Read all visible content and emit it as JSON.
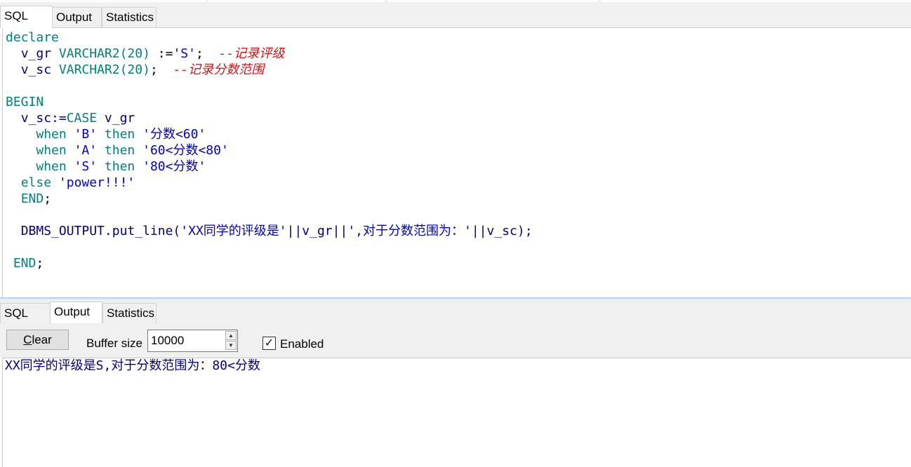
{
  "top_tabs": [
    {
      "label": "SQL",
      "active": true
    },
    {
      "label": "Output",
      "active": false
    },
    {
      "label": "Statistics",
      "active": false
    }
  ],
  "bottom_tabs": [
    {
      "label": "SQL",
      "active": false
    },
    {
      "label": "Output",
      "active": true
    },
    {
      "label": "Statistics",
      "active": false
    }
  ],
  "editor": {
    "l1": "declare",
    "l2_var": "v_gr",
    "l2_type": "VARCHAR2(20)",
    "l2_assign": ":=",
    "l2_str": "'S'",
    "l2_end": ";",
    "l2_cmt": "--记录评级",
    "l3_var": "v_sc",
    "l3_type": "VARCHAR2(20)",
    "l3_end": ";",
    "l3_cmt": "--记录分数范围",
    "l5": "BEGIN",
    "l6_var": "v_sc:=",
    "l6_kw": "CASE",
    "l6_rest": "v_gr",
    "when": "when",
    "then": "then",
    "l7_str1": "'B'",
    "l7_str2": "'分数<60'",
    "l8_str1": "'A'",
    "l8_str2": "'60<分数<80'",
    "l9_str1": "'S'",
    "l9_str2": "'80<分数'",
    "l10_kw": "else",
    "l10_str": "'power!!!'",
    "l11_kw": "END",
    "l11_end": ";",
    "l13_fn": "DBMS_OUTPUT.put_line(",
    "l13_str1": "'XX同学的评级是'",
    "l13_op1": "||v_gr||",
    "l13_str2": "',对于分数范围为：'",
    "l13_op2": "||v_sc);",
    "l15_kw": "END",
    "l15_end": ";"
  },
  "toolbar": {
    "clear_label_u": "C",
    "clear_label_rest": "lear",
    "buffer_label": "Buffer size",
    "buffer_value": "10000",
    "enabled_label": "Enabled",
    "enabled_checked": true,
    "check_glyph": "✓"
  },
  "output": {
    "line1": "XX同学的评级是S,对于分数范围为：80<分数"
  },
  "colors": {
    "keyword": "#008080",
    "string": "#0000d0",
    "comment": "#e01010",
    "plain": "#000080",
    "tab_bg": "#f0f0f0"
  }
}
